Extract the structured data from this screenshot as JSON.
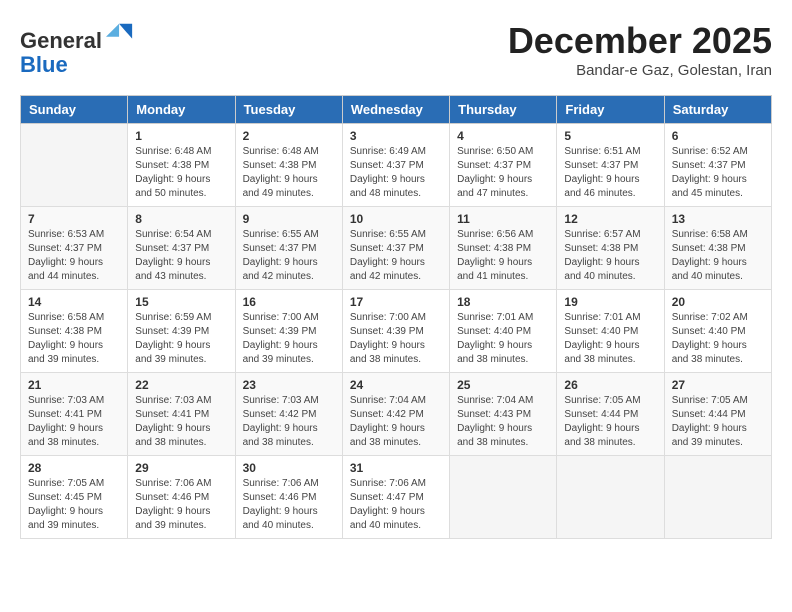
{
  "header": {
    "logo_general": "General",
    "logo_blue": "Blue",
    "month_title": "December 2025",
    "subtitle": "Bandar-e Gaz, Golestan, Iran"
  },
  "days_of_week": [
    "Sunday",
    "Monday",
    "Tuesday",
    "Wednesday",
    "Thursday",
    "Friday",
    "Saturday"
  ],
  "weeks": [
    [
      {
        "day": "",
        "sunrise": "",
        "sunset": "",
        "daylight": ""
      },
      {
        "day": "1",
        "sunrise": "Sunrise: 6:48 AM",
        "sunset": "Sunset: 4:38 PM",
        "daylight": "Daylight: 9 hours and 50 minutes."
      },
      {
        "day": "2",
        "sunrise": "Sunrise: 6:48 AM",
        "sunset": "Sunset: 4:38 PM",
        "daylight": "Daylight: 9 hours and 49 minutes."
      },
      {
        "day": "3",
        "sunrise": "Sunrise: 6:49 AM",
        "sunset": "Sunset: 4:37 PM",
        "daylight": "Daylight: 9 hours and 48 minutes."
      },
      {
        "day": "4",
        "sunrise": "Sunrise: 6:50 AM",
        "sunset": "Sunset: 4:37 PM",
        "daylight": "Daylight: 9 hours and 47 minutes."
      },
      {
        "day": "5",
        "sunrise": "Sunrise: 6:51 AM",
        "sunset": "Sunset: 4:37 PM",
        "daylight": "Daylight: 9 hours and 46 minutes."
      },
      {
        "day": "6",
        "sunrise": "Sunrise: 6:52 AM",
        "sunset": "Sunset: 4:37 PM",
        "daylight": "Daylight: 9 hours and 45 minutes."
      }
    ],
    [
      {
        "day": "7",
        "sunrise": "Sunrise: 6:53 AM",
        "sunset": "Sunset: 4:37 PM",
        "daylight": "Daylight: 9 hours and 44 minutes."
      },
      {
        "day": "8",
        "sunrise": "Sunrise: 6:54 AM",
        "sunset": "Sunset: 4:37 PM",
        "daylight": "Daylight: 9 hours and 43 minutes."
      },
      {
        "day": "9",
        "sunrise": "Sunrise: 6:55 AM",
        "sunset": "Sunset: 4:37 PM",
        "daylight": "Daylight: 9 hours and 42 minutes."
      },
      {
        "day": "10",
        "sunrise": "Sunrise: 6:55 AM",
        "sunset": "Sunset: 4:37 PM",
        "daylight": "Daylight: 9 hours and 42 minutes."
      },
      {
        "day": "11",
        "sunrise": "Sunrise: 6:56 AM",
        "sunset": "Sunset: 4:38 PM",
        "daylight": "Daylight: 9 hours and 41 minutes."
      },
      {
        "day": "12",
        "sunrise": "Sunrise: 6:57 AM",
        "sunset": "Sunset: 4:38 PM",
        "daylight": "Daylight: 9 hours and 40 minutes."
      },
      {
        "day": "13",
        "sunrise": "Sunrise: 6:58 AM",
        "sunset": "Sunset: 4:38 PM",
        "daylight": "Daylight: 9 hours and 40 minutes."
      }
    ],
    [
      {
        "day": "14",
        "sunrise": "Sunrise: 6:58 AM",
        "sunset": "Sunset: 4:38 PM",
        "daylight": "Daylight: 9 hours and 39 minutes."
      },
      {
        "day": "15",
        "sunrise": "Sunrise: 6:59 AM",
        "sunset": "Sunset: 4:39 PM",
        "daylight": "Daylight: 9 hours and 39 minutes."
      },
      {
        "day": "16",
        "sunrise": "Sunrise: 7:00 AM",
        "sunset": "Sunset: 4:39 PM",
        "daylight": "Daylight: 9 hours and 39 minutes."
      },
      {
        "day": "17",
        "sunrise": "Sunrise: 7:00 AM",
        "sunset": "Sunset: 4:39 PM",
        "daylight": "Daylight: 9 hours and 38 minutes."
      },
      {
        "day": "18",
        "sunrise": "Sunrise: 7:01 AM",
        "sunset": "Sunset: 4:40 PM",
        "daylight": "Daylight: 9 hours and 38 minutes."
      },
      {
        "day": "19",
        "sunrise": "Sunrise: 7:01 AM",
        "sunset": "Sunset: 4:40 PM",
        "daylight": "Daylight: 9 hours and 38 minutes."
      },
      {
        "day": "20",
        "sunrise": "Sunrise: 7:02 AM",
        "sunset": "Sunset: 4:40 PM",
        "daylight": "Daylight: 9 hours and 38 minutes."
      }
    ],
    [
      {
        "day": "21",
        "sunrise": "Sunrise: 7:03 AM",
        "sunset": "Sunset: 4:41 PM",
        "daylight": "Daylight: 9 hours and 38 minutes."
      },
      {
        "day": "22",
        "sunrise": "Sunrise: 7:03 AM",
        "sunset": "Sunset: 4:41 PM",
        "daylight": "Daylight: 9 hours and 38 minutes."
      },
      {
        "day": "23",
        "sunrise": "Sunrise: 7:03 AM",
        "sunset": "Sunset: 4:42 PM",
        "daylight": "Daylight: 9 hours and 38 minutes."
      },
      {
        "day": "24",
        "sunrise": "Sunrise: 7:04 AM",
        "sunset": "Sunset: 4:42 PM",
        "daylight": "Daylight: 9 hours and 38 minutes."
      },
      {
        "day": "25",
        "sunrise": "Sunrise: 7:04 AM",
        "sunset": "Sunset: 4:43 PM",
        "daylight": "Daylight: 9 hours and 38 minutes."
      },
      {
        "day": "26",
        "sunrise": "Sunrise: 7:05 AM",
        "sunset": "Sunset: 4:44 PM",
        "daylight": "Daylight: 9 hours and 38 minutes."
      },
      {
        "day": "27",
        "sunrise": "Sunrise: 7:05 AM",
        "sunset": "Sunset: 4:44 PM",
        "daylight": "Daylight: 9 hours and 39 minutes."
      }
    ],
    [
      {
        "day": "28",
        "sunrise": "Sunrise: 7:05 AM",
        "sunset": "Sunset: 4:45 PM",
        "daylight": "Daylight: 9 hours and 39 minutes."
      },
      {
        "day": "29",
        "sunrise": "Sunrise: 7:06 AM",
        "sunset": "Sunset: 4:46 PM",
        "daylight": "Daylight: 9 hours and 39 minutes."
      },
      {
        "day": "30",
        "sunrise": "Sunrise: 7:06 AM",
        "sunset": "Sunset: 4:46 PM",
        "daylight": "Daylight: 9 hours and 40 minutes."
      },
      {
        "day": "31",
        "sunrise": "Sunrise: 7:06 AM",
        "sunset": "Sunset: 4:47 PM",
        "daylight": "Daylight: 9 hours and 40 minutes."
      },
      {
        "day": "",
        "sunrise": "",
        "sunset": "",
        "daylight": ""
      },
      {
        "day": "",
        "sunrise": "",
        "sunset": "",
        "daylight": ""
      },
      {
        "day": "",
        "sunrise": "",
        "sunset": "",
        "daylight": ""
      }
    ]
  ]
}
